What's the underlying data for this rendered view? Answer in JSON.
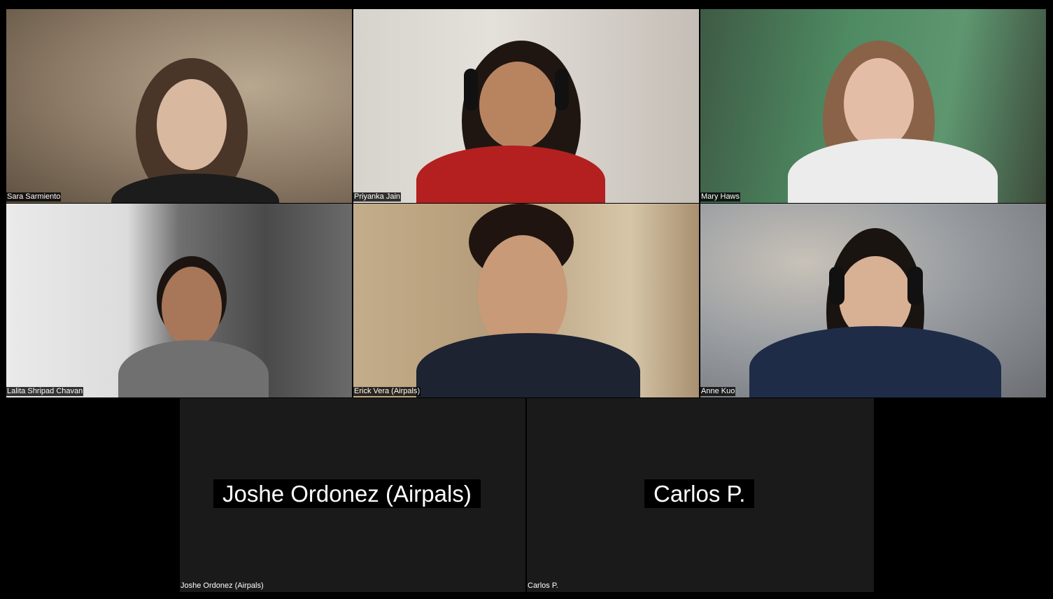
{
  "participants": [
    {
      "name": "Sara Sarmiento",
      "bg": "#8c7a66",
      "body": "#1c1c1c",
      "skin": "#d9b8a0",
      "hair": "#4a3628"
    },
    {
      "name": "Priyanka Jain",
      "bg": "#cfcac4",
      "body": "#b3201f",
      "skin": "#b88460",
      "hair": "#1f1612"
    },
    {
      "name": "Mary Haws",
      "bg": "#4e8a62",
      "body": "#ececec",
      "skin": "#e3bda6",
      "hair": "#8a6248"
    },
    {
      "name": "Lalita Shripad Chavan",
      "bg": "#6e6e6e",
      "body": "#707070",
      "skin": "#a87658",
      "hair": "#1c1410"
    },
    {
      "name": "Erick Vera (Airpals)",
      "bg": "#b59c7a",
      "body": "#1d2330",
      "skin": "#c89a78",
      "hair": "#1f1410"
    },
    {
      "name": "Anne Kuo",
      "bg": "#8a8e92",
      "body": "#1f2c48",
      "skin": "#d8b094",
      "hair": "#1a1410"
    }
  ],
  "audio_only": [
    {
      "name": "Joshe Ordonez (Airpals)",
      "display": "Joshe Ordonez (Airpals)"
    },
    {
      "name": "Carlos P.",
      "display": "Carlos P."
    }
  ]
}
